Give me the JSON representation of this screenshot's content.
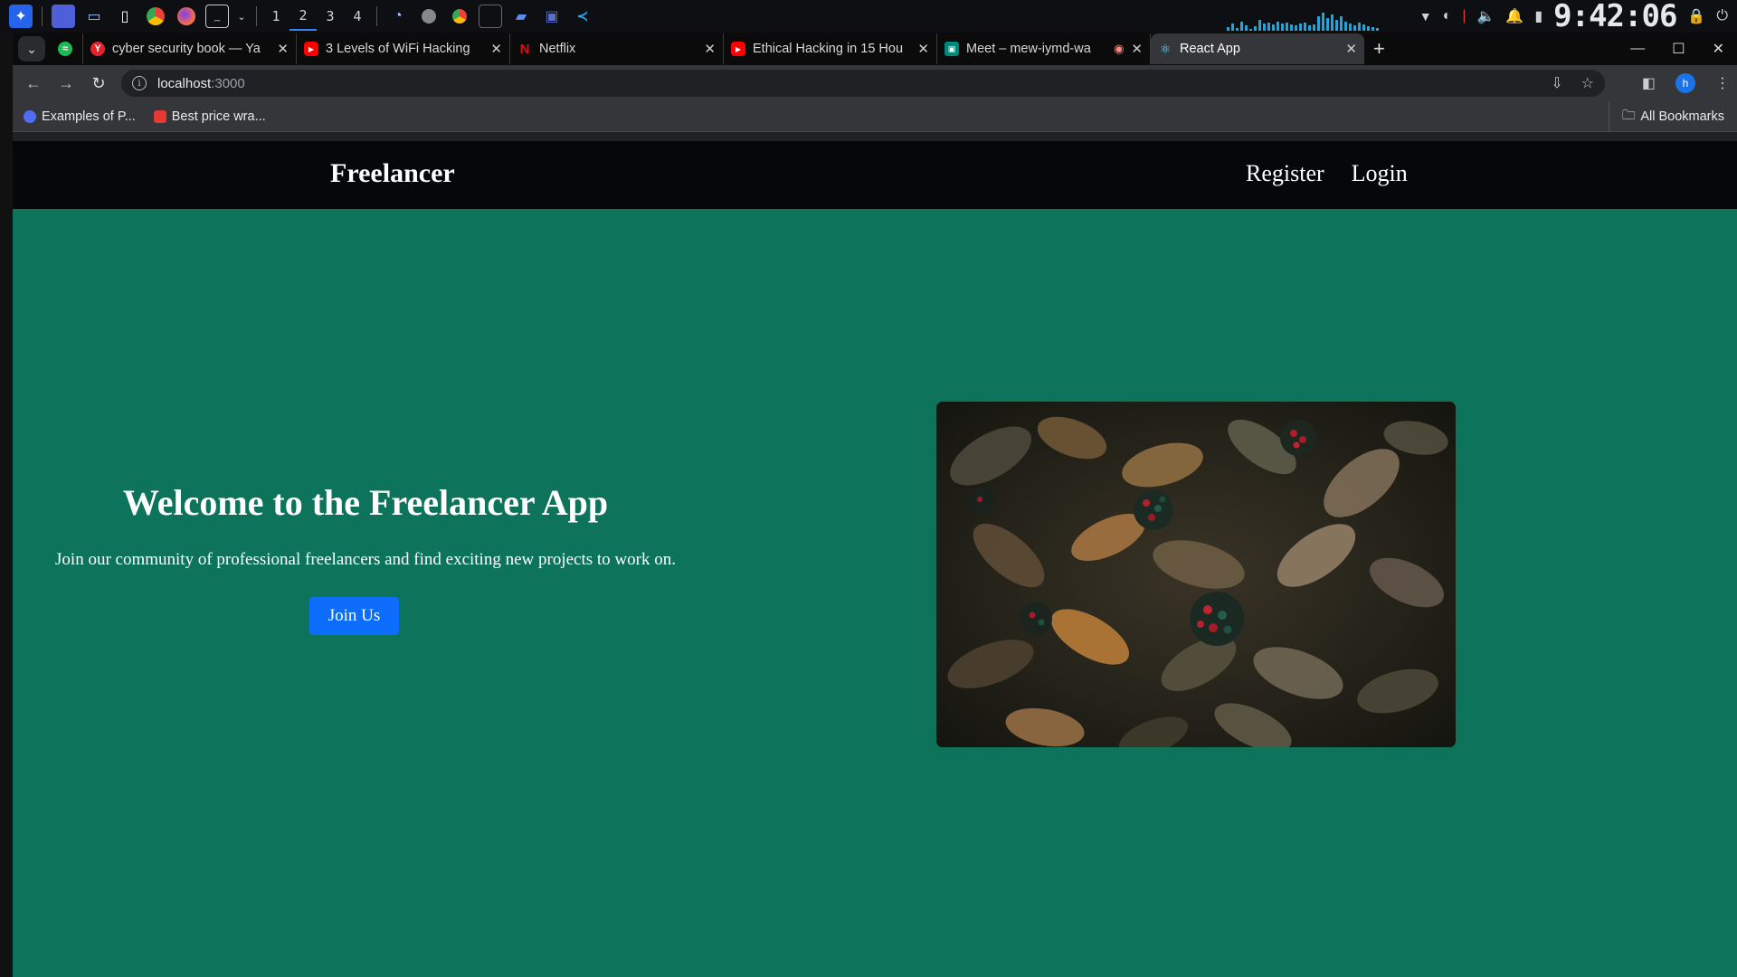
{
  "taskbar": {
    "workspaces": [
      "1",
      "2",
      "3",
      "4"
    ],
    "clock": "9:42:06"
  },
  "browser": {
    "tabs": [
      {
        "title": "cyber security book — Ya",
        "favicon_color": "#e3222c",
        "favicon_glyph": "Y"
      },
      {
        "title": "3 Levels of WiFi Hacking",
        "favicon_color": "#ff0000",
        "favicon_glyph": "▶"
      },
      {
        "title": "Netflix",
        "favicon_color": "#000000",
        "favicon_glyph": "N"
      },
      {
        "title": "Ethical Hacking in 15 Hou",
        "favicon_color": "#ff0000",
        "favicon_glyph": "▶"
      },
      {
        "title": "Meet – mew-iymd-wa",
        "favicon_color": "#00897b",
        "favicon_glyph": "▣"
      },
      {
        "title": "React App",
        "favicon_color": "#61dafb",
        "favicon_glyph": "⚛"
      }
    ],
    "url_host": "localhost",
    "url_port": ":3000",
    "profile_initial": "h",
    "bookmarks": [
      {
        "label": "Examples of P...",
        "color": "#4f6df5"
      },
      {
        "label": "Best price wra...",
        "color": "#e53935"
      }
    ],
    "all_bookmarks_label": "All Bookmarks"
  },
  "app": {
    "brand": "Freelancer",
    "nav": {
      "register": "Register",
      "login": "Login"
    },
    "hero": {
      "title": "Welcome to the Freelancer App",
      "subtitle": "Join our community of professional freelancers and find exciting new projects to work on.",
      "cta": "Join Us"
    },
    "colors": {
      "background": "#0d735a",
      "navbar": "#060708",
      "button": "#0d6efd"
    }
  }
}
